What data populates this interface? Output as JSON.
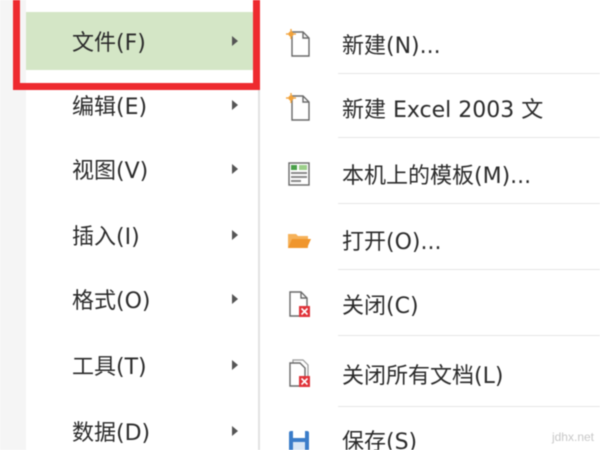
{
  "main_menu": {
    "items": [
      {
        "label": "文件(F)",
        "active": true
      },
      {
        "label": "编辑(E)",
        "active": false
      },
      {
        "label": "视图(V)",
        "active": false
      },
      {
        "label": "插入(I)",
        "active": false
      },
      {
        "label": "格式(O)",
        "active": false
      },
      {
        "label": "工具(T)",
        "active": false
      },
      {
        "label": "数据(D)",
        "active": false
      }
    ]
  },
  "file_submenu": {
    "items": [
      {
        "label": "新建(N)...",
        "icon": "new-document-icon"
      },
      {
        "label": "新建 Excel 2003 文",
        "icon": "new-excel-document-icon"
      },
      {
        "label": "本机上的模板(M)...",
        "icon": "template-icon"
      },
      {
        "label": "打开(O)...",
        "icon": "open-folder-icon"
      },
      {
        "label": "关闭(C)",
        "icon": "close-document-icon"
      },
      {
        "label": "关闭所有文档(L)",
        "icon": "close-all-documents-icon"
      },
      {
        "label": "保存(S)",
        "icon": "save-icon"
      }
    ]
  },
  "watermark": "jdhx.net",
  "colors": {
    "active_item_bg": "#d4e6c6",
    "highlight_border": "#ee2a2f",
    "text": "#2b2b2b",
    "open_folder": "#f0962d",
    "close_mark": "#e0333a",
    "save_blue": "#3a7cc9",
    "template_green": "#4aa04a"
  }
}
